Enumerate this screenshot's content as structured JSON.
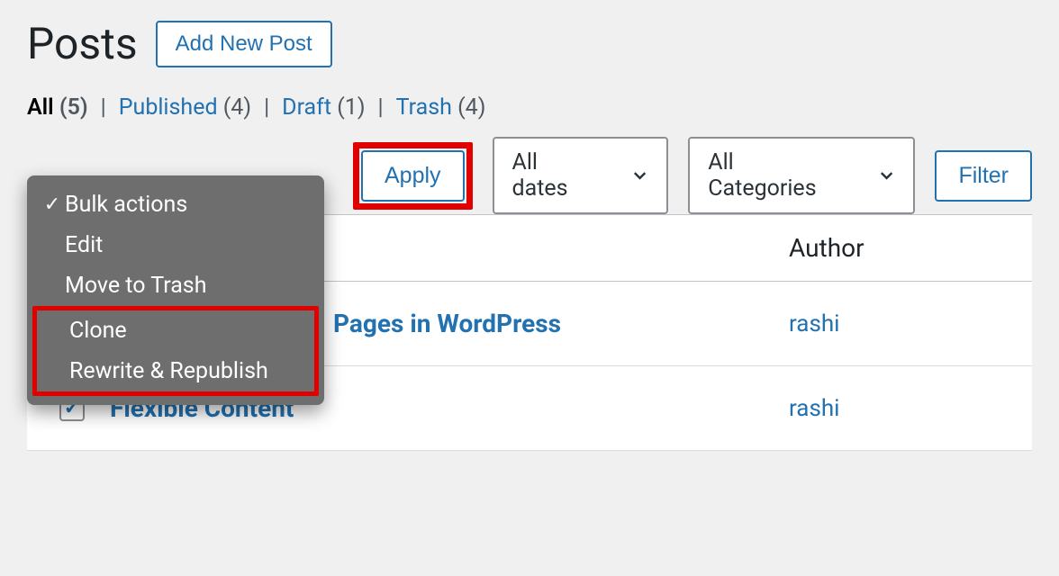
{
  "header": {
    "title": "Posts",
    "add_new_label": "Add New Post"
  },
  "status_tabs": {
    "all": {
      "label": "All",
      "count": "(5)"
    },
    "published": {
      "label": "Published",
      "count": "(4)"
    },
    "draft": {
      "label": "Draft",
      "count": "(1)"
    },
    "trash": {
      "label": "Trash",
      "count": "(4)"
    }
  },
  "bulk_actions": {
    "items": [
      {
        "label": "Bulk actions",
        "checked": true
      },
      {
        "label": "Edit",
        "checked": false
      },
      {
        "label": "Move to Trash",
        "checked": false
      },
      {
        "label": "Clone",
        "checked": false
      },
      {
        "label": "Rewrite & Republish",
        "checked": false
      }
    ]
  },
  "controls": {
    "apply_label": "Apply",
    "dates_label": "All dates",
    "categories_label": "All Categories",
    "filter_label": "Filter"
  },
  "table": {
    "author_header": "Author",
    "rows": [
      {
        "title": "Pages in WordPress",
        "author": "rashi",
        "checked": false
      },
      {
        "title": "Flexible Content",
        "author": "rashi",
        "checked": true
      }
    ]
  }
}
